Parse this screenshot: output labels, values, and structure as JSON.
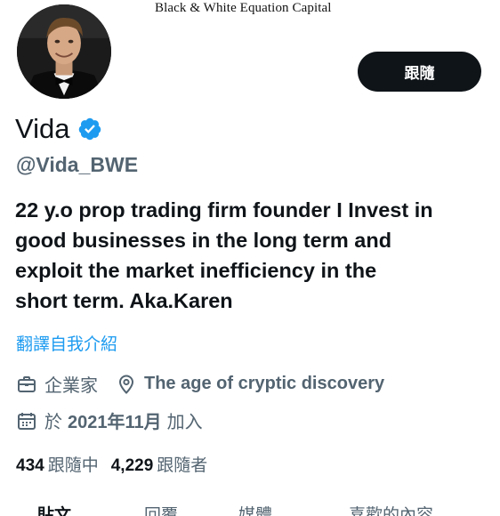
{
  "watermark": "Black & White Equation Capital",
  "profile": {
    "display_name": "Vida",
    "handle": "@Vida_BWE",
    "follow_label": "跟隨",
    "bio_lines": [
      "22 y.o prop trading firm founder I Invest in",
      "good businesses in the long term and",
      "exploit the market inefficiency in the",
      "short term. Aka.Karen"
    ],
    "translate_label": "翻譯自我介紹",
    "category": "企業家",
    "location": "The age of cryptic discovery",
    "joined_prefix": "於",
    "joined_date": "2021年11月",
    "joined_suffix": "加入"
  },
  "stats": {
    "following_count": "434",
    "following_label": "跟隨中",
    "followers_count": "4,229",
    "followers_label": "跟隨者"
  },
  "tabs": [
    {
      "label": "貼文",
      "active": true
    },
    {
      "label": "回覆",
      "active": false
    },
    {
      "label": "媒體",
      "active": false
    },
    {
      "label": "喜歡的內容",
      "active": false
    }
  ],
  "colors": {
    "accent": "#1d9bf0",
    "text_primary": "#0f1419",
    "text_secondary": "#536471",
    "button_bg": "#0f1419"
  },
  "icons": {
    "verified": "verified-badge-icon",
    "category": "briefcase-icon",
    "location": "location-pin-icon",
    "joined": "calendar-icon"
  }
}
